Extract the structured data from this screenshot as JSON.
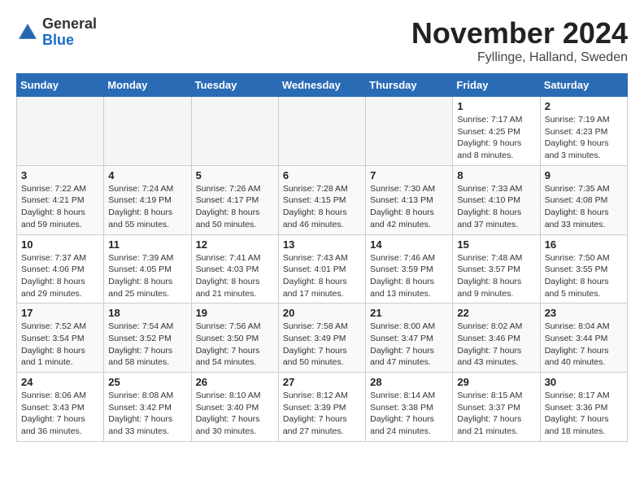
{
  "header": {
    "logo_general": "General",
    "logo_blue": "Blue",
    "month_title": "November 2024",
    "location": "Fyllinge, Halland, Sweden"
  },
  "calendar": {
    "days_of_week": [
      "Sunday",
      "Monday",
      "Tuesday",
      "Wednesday",
      "Thursday",
      "Friday",
      "Saturday"
    ],
    "weeks": [
      [
        {
          "day": "",
          "info": ""
        },
        {
          "day": "",
          "info": ""
        },
        {
          "day": "",
          "info": ""
        },
        {
          "day": "",
          "info": ""
        },
        {
          "day": "",
          "info": ""
        },
        {
          "day": "1",
          "info": "Sunrise: 7:17 AM\nSunset: 4:25 PM\nDaylight: 9 hours\nand 8 minutes."
        },
        {
          "day": "2",
          "info": "Sunrise: 7:19 AM\nSunset: 4:23 PM\nDaylight: 9 hours\nand 3 minutes."
        }
      ],
      [
        {
          "day": "3",
          "info": "Sunrise: 7:22 AM\nSunset: 4:21 PM\nDaylight: 8 hours\nand 59 minutes."
        },
        {
          "day": "4",
          "info": "Sunrise: 7:24 AM\nSunset: 4:19 PM\nDaylight: 8 hours\nand 55 minutes."
        },
        {
          "day": "5",
          "info": "Sunrise: 7:26 AM\nSunset: 4:17 PM\nDaylight: 8 hours\nand 50 minutes."
        },
        {
          "day": "6",
          "info": "Sunrise: 7:28 AM\nSunset: 4:15 PM\nDaylight: 8 hours\nand 46 minutes."
        },
        {
          "day": "7",
          "info": "Sunrise: 7:30 AM\nSunset: 4:13 PM\nDaylight: 8 hours\nand 42 minutes."
        },
        {
          "day": "8",
          "info": "Sunrise: 7:33 AM\nSunset: 4:10 PM\nDaylight: 8 hours\nand 37 minutes."
        },
        {
          "day": "9",
          "info": "Sunrise: 7:35 AM\nSunset: 4:08 PM\nDaylight: 8 hours\nand 33 minutes."
        }
      ],
      [
        {
          "day": "10",
          "info": "Sunrise: 7:37 AM\nSunset: 4:06 PM\nDaylight: 8 hours\nand 29 minutes."
        },
        {
          "day": "11",
          "info": "Sunrise: 7:39 AM\nSunset: 4:05 PM\nDaylight: 8 hours\nand 25 minutes."
        },
        {
          "day": "12",
          "info": "Sunrise: 7:41 AM\nSunset: 4:03 PM\nDaylight: 8 hours\nand 21 minutes."
        },
        {
          "day": "13",
          "info": "Sunrise: 7:43 AM\nSunset: 4:01 PM\nDaylight: 8 hours\nand 17 minutes."
        },
        {
          "day": "14",
          "info": "Sunrise: 7:46 AM\nSunset: 3:59 PM\nDaylight: 8 hours\nand 13 minutes."
        },
        {
          "day": "15",
          "info": "Sunrise: 7:48 AM\nSunset: 3:57 PM\nDaylight: 8 hours\nand 9 minutes."
        },
        {
          "day": "16",
          "info": "Sunrise: 7:50 AM\nSunset: 3:55 PM\nDaylight: 8 hours\nand 5 minutes."
        }
      ],
      [
        {
          "day": "17",
          "info": "Sunrise: 7:52 AM\nSunset: 3:54 PM\nDaylight: 8 hours\nand 1 minute."
        },
        {
          "day": "18",
          "info": "Sunrise: 7:54 AM\nSunset: 3:52 PM\nDaylight: 7 hours\nand 58 minutes."
        },
        {
          "day": "19",
          "info": "Sunrise: 7:56 AM\nSunset: 3:50 PM\nDaylight: 7 hours\nand 54 minutes."
        },
        {
          "day": "20",
          "info": "Sunrise: 7:58 AM\nSunset: 3:49 PM\nDaylight: 7 hours\nand 50 minutes."
        },
        {
          "day": "21",
          "info": "Sunrise: 8:00 AM\nSunset: 3:47 PM\nDaylight: 7 hours\nand 47 minutes."
        },
        {
          "day": "22",
          "info": "Sunrise: 8:02 AM\nSunset: 3:46 PM\nDaylight: 7 hours\nand 43 minutes."
        },
        {
          "day": "23",
          "info": "Sunrise: 8:04 AM\nSunset: 3:44 PM\nDaylight: 7 hours\nand 40 minutes."
        }
      ],
      [
        {
          "day": "24",
          "info": "Sunrise: 8:06 AM\nSunset: 3:43 PM\nDaylight: 7 hours\nand 36 minutes."
        },
        {
          "day": "25",
          "info": "Sunrise: 8:08 AM\nSunset: 3:42 PM\nDaylight: 7 hours\nand 33 minutes."
        },
        {
          "day": "26",
          "info": "Sunrise: 8:10 AM\nSunset: 3:40 PM\nDaylight: 7 hours\nand 30 minutes."
        },
        {
          "day": "27",
          "info": "Sunrise: 8:12 AM\nSunset: 3:39 PM\nDaylight: 7 hours\nand 27 minutes."
        },
        {
          "day": "28",
          "info": "Sunrise: 8:14 AM\nSunset: 3:38 PM\nDaylight: 7 hours\nand 24 minutes."
        },
        {
          "day": "29",
          "info": "Sunrise: 8:15 AM\nSunset: 3:37 PM\nDaylight: 7 hours\nand 21 minutes."
        },
        {
          "day": "30",
          "info": "Sunrise: 8:17 AM\nSunset: 3:36 PM\nDaylight: 7 hours\nand 18 minutes."
        }
      ]
    ]
  }
}
